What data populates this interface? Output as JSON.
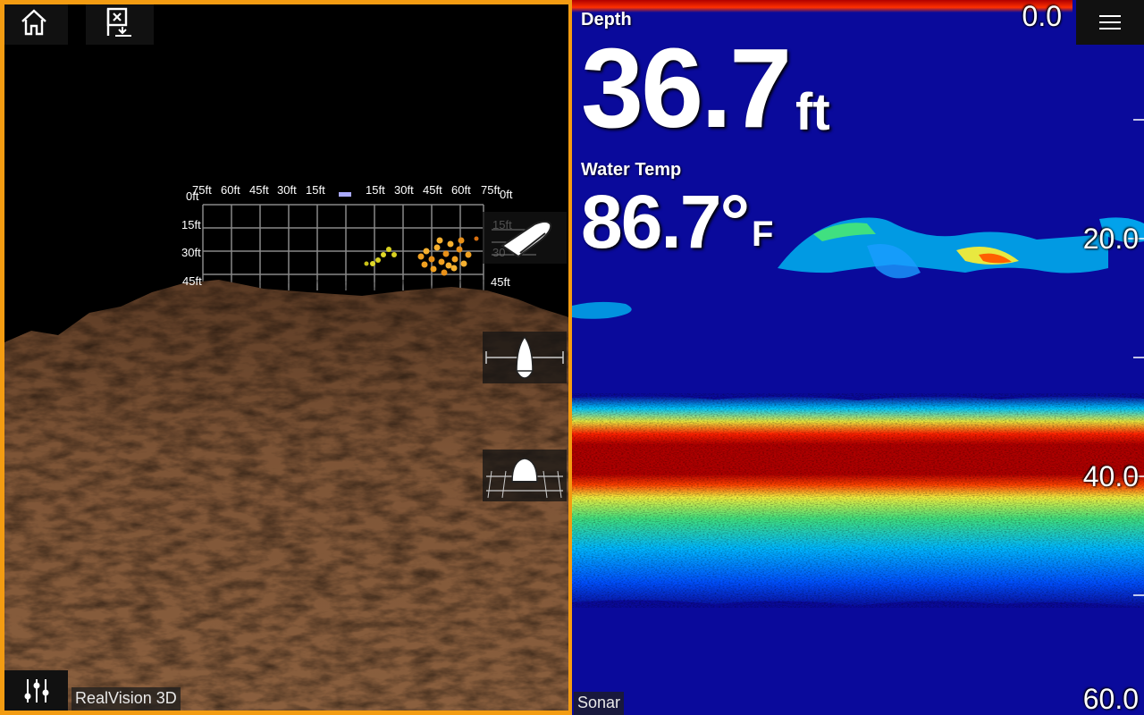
{
  "left_pane": {
    "label": "RealVision 3D",
    "grid": {
      "horizontal_labels": [
        "75ft",
        "60ft",
        "45ft",
        "30ft",
        "15ft",
        "15ft",
        "30ft",
        "45ft",
        "60ft",
        "75ft"
      ],
      "left_zero": "0ft",
      "right_zero": "0ft",
      "depth_labels_left": [
        "15ft",
        "30ft",
        "45ft"
      ],
      "depth_labels_right": [
        "15ft",
        "30",
        "45ft"
      ]
    },
    "buttons": {
      "home": "home-icon",
      "waypoint": "waypoint-icon",
      "settings": "sliders-icon",
      "view_perspective": "perspective-view-icon",
      "view_rear": "rear-view-icon",
      "view_side": "side-view-icon"
    }
  },
  "right_pane": {
    "label": "Sonar",
    "depth": {
      "caption": "Depth",
      "value": "36.7",
      "unit": "ft"
    },
    "water_temp": {
      "caption": "Water Temp",
      "value": "86.7°",
      "unit": "F"
    },
    "depth_scale": [
      "0.0",
      "20.0",
      "40.0",
      "60.0"
    ],
    "menu": "menu-icon",
    "colors": {
      "background": "#0a0a9b",
      "bottom_return": "#b50000",
      "accent_border": "#f39c12"
    }
  }
}
